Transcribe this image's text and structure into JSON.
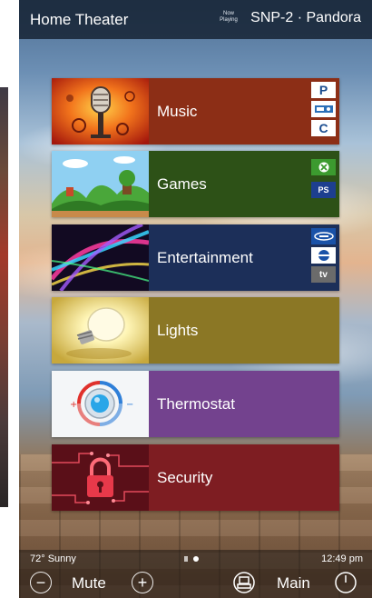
{
  "header": {
    "title": "Home Theater",
    "now_playing_line1": "Now",
    "now_playing_line2": "Playing",
    "source": "SNP-2 · Pandora"
  },
  "tiles": [
    {
      "label": "Music",
      "color": "#8c2e16",
      "badges": [
        "pandora-icon",
        "radio-icon",
        "siriusxm-icon"
      ]
    },
    {
      "label": "Games",
      "color": "#2d5117",
      "badges": [
        "xbox-icon",
        "playstation-icon"
      ]
    },
    {
      "label": "Entertainment",
      "color": "#1c2f59",
      "badges": [
        "bluray-icon",
        "directv-icon",
        "appletv-icon"
      ]
    },
    {
      "label": "Lights",
      "color": "#8b7725",
      "badges": []
    },
    {
      "label": "Thermostat",
      "color": "#73428e",
      "badges": []
    },
    {
      "label": "Security",
      "color": "#7e1d22",
      "badges": []
    }
  ],
  "badge_text": {
    "pandora": "P",
    "siriusxm": "C",
    "playstation": "PS",
    "appletv": "tv"
  },
  "status": {
    "weather": "72°  Sunny",
    "time": "12:49 pm",
    "page_count": 2,
    "active_page": 2
  },
  "controls": {
    "volume_down_symbol": "−",
    "mute_label": "Mute",
    "volume_up_symbol": "+",
    "main_label": "Main"
  }
}
